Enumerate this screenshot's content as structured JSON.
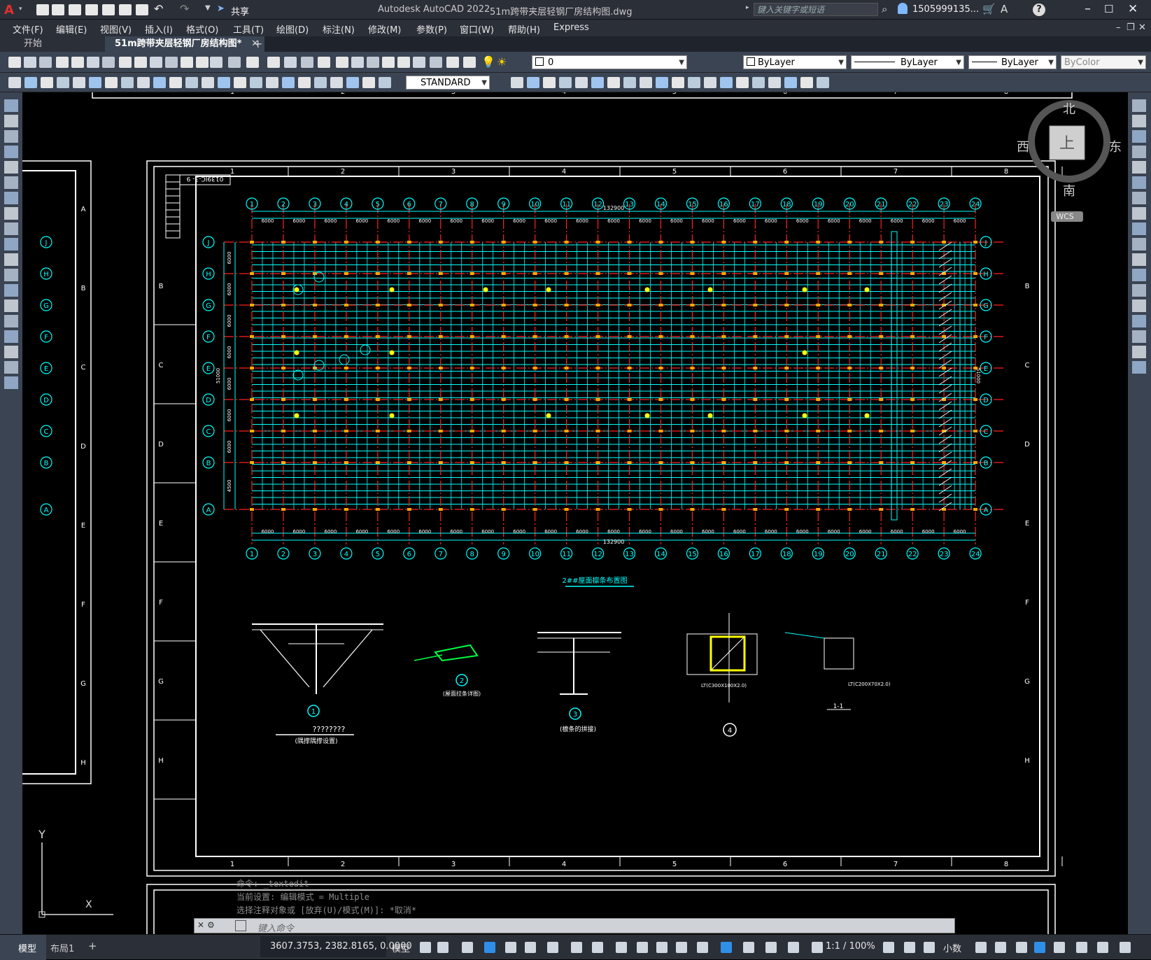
{
  "window": {
    "app_title": "Autodesk AutoCAD 2022",
    "doc_title": "51m跨带夹层轻钢厂房结构图.dwg",
    "share_label": "共享",
    "search_placeholder": "键入关键字或短语",
    "user": "1505999135...",
    "help": "?"
  },
  "menu": [
    "文件(F)",
    "编辑(E)",
    "视图(V)",
    "插入(I)",
    "格式(O)",
    "工具(T)",
    "绘图(D)",
    "标注(N)",
    "修改(M)",
    "参数(P)",
    "窗口(W)",
    "帮助(H)",
    "Express"
  ],
  "tabs": [
    {
      "label": "开始"
    },
    {
      "label": "51m跨带夹层轻钢厂房结构图*"
    }
  ],
  "toolbar": {
    "layer_value": "0",
    "color_value": "ByLayer",
    "linetype_value": "ByLayer",
    "lineweight_value": "ByLayer",
    "plotstyle_value": "ByColor",
    "textstyle_value": "STANDARD"
  },
  "viewcube": {
    "north": "北",
    "south": "南",
    "east": "东",
    "west": "西",
    "top": "上",
    "wcs": "WCS"
  },
  "drawing": {
    "frame_cols": [
      "1",
      "2",
      "3",
      "4",
      "5",
      "6",
      "7",
      "8"
    ],
    "frame_rows_left": [
      "A",
      "B",
      "C",
      "D",
      "E",
      "F",
      "G",
      "H"
    ],
    "frame_rows_sheet": [
      "B",
      "C",
      "D",
      "E",
      "F",
      "G",
      "H"
    ],
    "grid_cols": [
      "1",
      "2",
      "3",
      "4",
      "5",
      "6",
      "7",
      "8",
      "9",
      "10",
      "11",
      "12",
      "13",
      "14",
      "15",
      "16",
      "17",
      "18",
      "19",
      "20",
      "21",
      "22",
      "23",
      "24"
    ],
    "grid_rows": [
      "J",
      "H",
      "G",
      "F",
      "E",
      "D",
      "C",
      "B",
      "A"
    ],
    "bay_dim": "6000",
    "total_dim": "132900",
    "total_dim_bottom": "132900",
    "span_dim": "51000",
    "row_dims": [
      "6000",
      "6000",
      "6000",
      "6000",
      "6000",
      "6000",
      "6000",
      "4500",
      "4500"
    ],
    "sheet_no": "0139JC-3- 9",
    "plan_title": "2##屋面檩条布置图",
    "detail_labels": [
      "1",
      "2",
      "3",
      "4"
    ],
    "detail1_title": "(隅撑隅撑设置)",
    "detail1_question": "????????",
    "detail2_title": "(屋面拉条详图)",
    "detail3_title": "(檩条的拼接)",
    "section_label": "1-1",
    "detail4_note": "LT(C200X70X2.0)",
    "detail4_note2": "LT(C300X100X2.0)"
  },
  "ucs": {
    "y": "Y",
    "x": "X"
  },
  "command": {
    "history": [
      "命令: _textedit",
      "当前设置: 编辑模式 = Multiple",
      "选择注释对象或 [放弃(U)/模式(M)]: *取消*"
    ],
    "placeholder": "键入命令"
  },
  "layout_tabs": [
    "模型",
    "布局1"
  ],
  "status": {
    "coords": "3607.3753, 2382.8165, 0.0000",
    "model": "模型",
    "scale": "1:1 / 100%",
    "units": "小数"
  },
  "colors": {
    "grid_red": "#ff2020",
    "purlin_cyan": "#00ffff",
    "accent": "#2f8fe8",
    "yellow": "#ffff00"
  }
}
